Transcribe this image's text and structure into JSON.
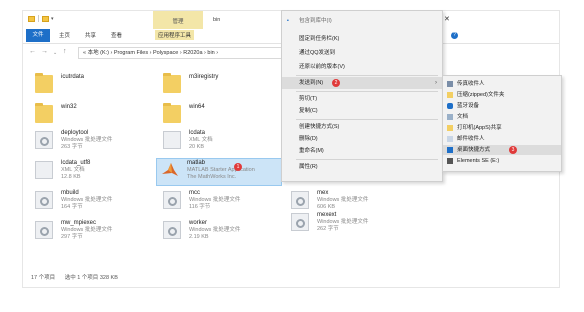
{
  "window": {
    "title": "bin",
    "context_tab": "管理",
    "ribbon_tabs": [
      "文件",
      "主页",
      "共享",
      "查看",
      "应用程序工具"
    ],
    "address": "« 本地 (K:) › Program Files › Polyspace › R2020a › bin ›"
  },
  "files": [
    {
      "name": "icutrdata",
      "l1": "",
      "l2": ""
    },
    {
      "name": "m3iregistry",
      "l1": "",
      "l2": ""
    },
    {
      "name": "win32",
      "l1": "",
      "l2": ""
    },
    {
      "name": "win64",
      "l1": "",
      "l2": ""
    },
    {
      "name": "deploytool",
      "l1": "Windows 批处理文件",
      "l2": "263 字节"
    },
    {
      "name": "lcdata",
      "l1": "XML 文档",
      "l2": "20 KB"
    },
    {
      "name": "lcdata_utf8",
      "l1": "XML 文档",
      "l2": "12.8 KB"
    },
    {
      "name": "matlab",
      "l1": "MATLAB Starter Application",
      "l2": "The MathWorks Inc."
    },
    {
      "name": "mbuild",
      "l1": "Windows 批处理文件",
      "l2": "164 字节"
    },
    {
      "name": "mcc",
      "l1": "Windows 批处理文件",
      "l2": "116 字节"
    },
    {
      "name": "mw_mpiexec",
      "l1": "Windows 批处理文件",
      "l2": "297 字节"
    },
    {
      "name": "worker",
      "l1": "Windows 批处理文件",
      "l2": "2.19 KB"
    },
    {
      "name": "mex",
      "l1": "Windows 批处理文件",
      "l2": "606 KB"
    },
    {
      "name": "mexext",
      "l1": "Windows 批处理文件",
      "l2": "262 字节"
    }
  ],
  "status": {
    "count": "17 个项目",
    "selected": "选中 1 个项目 328 KB"
  },
  "context_menu": {
    "items": [
      "包含到库中(I)",
      "固定到任务栏(K)",
      "通过QQ发送到",
      "还原以前的版本(V)",
      "发送到(N)",
      "剪切(T)",
      "复制(C)",
      "创建快捷方式(S)",
      "删除(D)",
      "重命名(M)",
      "属性(R)"
    ],
    "top_partial": "包含到库中(I)"
  },
  "submenu": {
    "items": [
      "传真收件人",
      "压缩(zipped)文件夹",
      "蓝牙设备",
      "文档",
      "打印机(AppS)共享",
      "邮件收件人",
      "桌面快捷方式",
      "Elements SE (E:)"
    ]
  },
  "badges": {
    "matlab": "1",
    "send_to": "2",
    "desktop": "3"
  }
}
